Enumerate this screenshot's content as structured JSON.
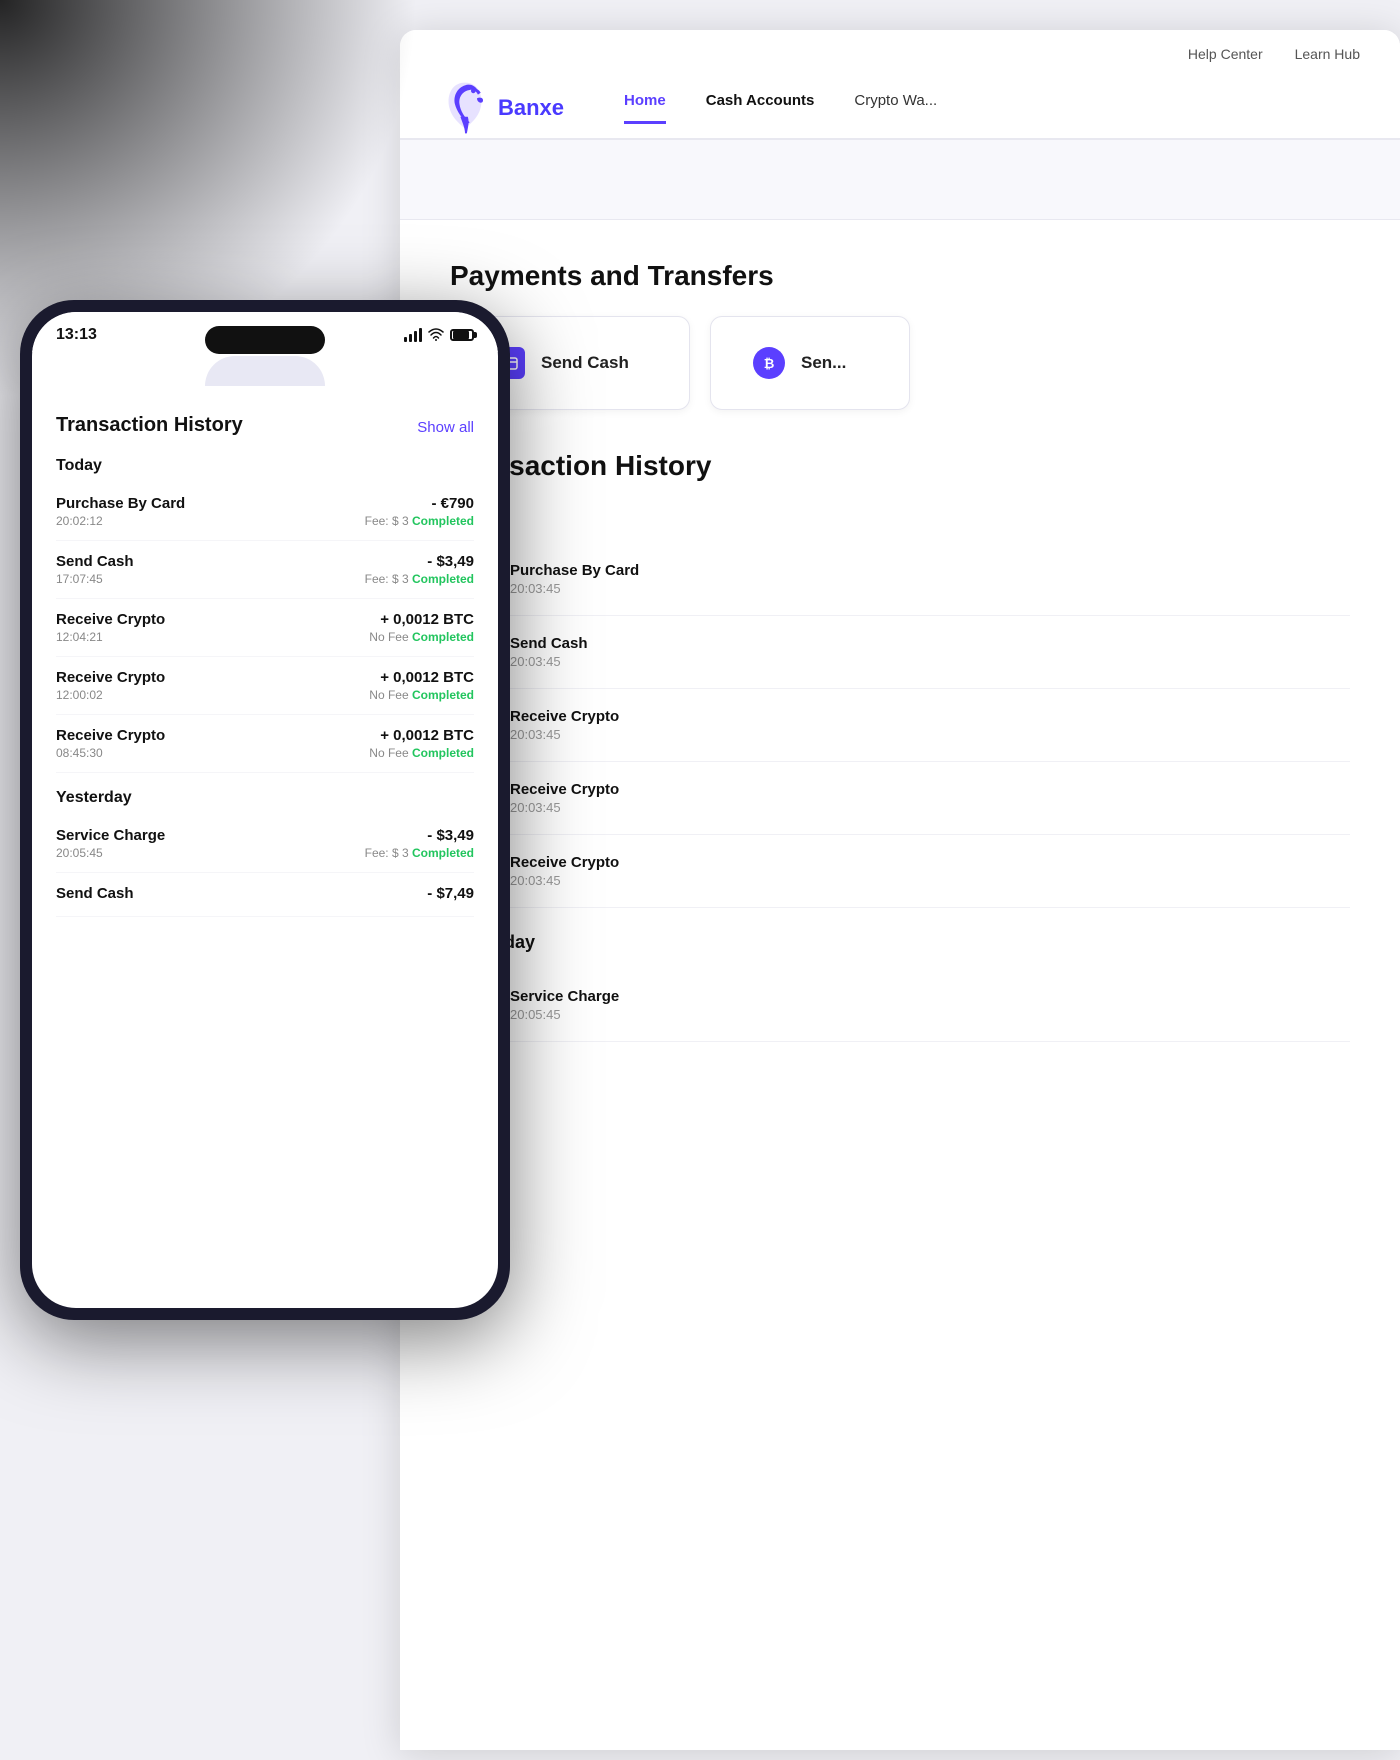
{
  "brand": {
    "name": "Banxe",
    "logo_alt": "Banxe dolphin logo"
  },
  "top_nav": {
    "links": [
      "Help Center",
      "Learn Hub"
    ],
    "nav_items": [
      {
        "label": "Home",
        "active": true
      },
      {
        "label": "Cash Accounts",
        "bold": true
      },
      {
        "label": "Crypto Wa...",
        "bold": false
      }
    ]
  },
  "payments": {
    "title": "Payments and Transfers",
    "cards": [
      {
        "label": "Send Cash",
        "icon": "send-cash"
      },
      {
        "label": "Sen...",
        "icon": "send-crypto"
      }
    ]
  },
  "transaction_history": {
    "title": "Transaction History",
    "periods": [
      {
        "label": "Today",
        "transactions": [
          {
            "name": "Purchase By Card",
            "time": "20:03:45",
            "icon": "card"
          },
          {
            "name": "Send Cash",
            "time": "20:03:45",
            "icon": "send"
          },
          {
            "name": "Receive Crypto",
            "time": "20:03:45",
            "icon": "crypto"
          },
          {
            "name": "Receive Crypto",
            "time": "20:03:45",
            "icon": "crypto"
          },
          {
            "name": "Receive Crypto",
            "time": "20:03:45",
            "icon": "crypto"
          }
        ]
      },
      {
        "label": "Yesterday",
        "transactions": [
          {
            "name": "Service Charge",
            "time": "20:05:45",
            "icon": "charge"
          }
        ]
      }
    ]
  },
  "phone": {
    "time": "13:13",
    "status_icons": [
      "signal",
      "wifi",
      "battery"
    ],
    "section_title": "Transaction History",
    "show_all": "Show all",
    "periods": [
      {
        "label": "Today",
        "transactions": [
          {
            "name": "Purchase By Card",
            "time": "20:02:12",
            "amount": "- €790",
            "fee": "Fee: $ 3",
            "status": "Completed"
          },
          {
            "name": "Send Cash",
            "time": "17:07:45",
            "amount": "- $3,49",
            "fee": "Fee: $ 3",
            "status": "Completed"
          },
          {
            "name": "Receive Crypto",
            "time": "12:04:21",
            "amount": "+ 0,0012 BTC",
            "fee": "No Fee",
            "status": "Completed"
          },
          {
            "name": "Receive Crypto",
            "time": "12:00:02",
            "amount": "+ 0,0012 BTC",
            "fee": "No Fee",
            "status": "Completed"
          },
          {
            "name": "Receive Crypto",
            "time": "08:45:30",
            "amount": "+ 0,0012 BTC",
            "fee": "No Fee",
            "status": "Completed"
          }
        ]
      },
      {
        "label": "Yesterday",
        "transactions": [
          {
            "name": "Service Charge",
            "time": "20:05:45",
            "amount": "- $3,49",
            "fee": "Fee: $ 3",
            "status": "Completed"
          },
          {
            "name": "Send Cash",
            "time": "",
            "amount": "- $7,49",
            "fee": "",
            "status": ""
          }
        ]
      }
    ]
  },
  "colors": {
    "brand_purple": "#5b3fff",
    "completed_green": "#22c55e",
    "text_dark": "#111111",
    "text_muted": "#888888",
    "bg_light": "#f0f0f5",
    "card_bg": "#ffffff"
  }
}
